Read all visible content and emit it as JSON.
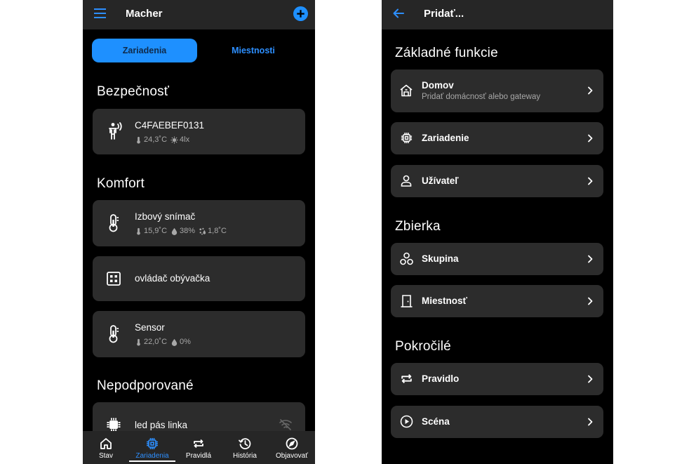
{
  "left": {
    "appbar": {
      "title": "Macher",
      "menu_icon": "menu-icon",
      "add_icon": "add-circle-icon"
    },
    "tabs": [
      {
        "label": "Zariadenia",
        "active": true
      },
      {
        "label": "Miestnosti",
        "active": false
      }
    ],
    "sections": {
      "bezpecnost": {
        "title": "Bezpečnosť",
        "devices": [
          {
            "name": "C4FAEBEF0131",
            "icon": "motion-sensor-icon",
            "temp": "24,3˚C",
            "light": "4lx"
          }
        ]
      },
      "komfort": {
        "title": "Komfort",
        "devices": [
          {
            "name": "Izbový snímač",
            "icon": "thermometer-icon",
            "temp": "15,9˚C",
            "humidity": "38%",
            "dewpoint": "1,8˚C"
          },
          {
            "name": "ovládač obývačka",
            "icon": "switch-panel-icon"
          },
          {
            "name": "Sensor",
            "icon": "thermometer-icon",
            "temp": "22,0˚C",
            "humidity": "0%"
          }
        ]
      },
      "nepodporovane": {
        "title": "Nepodporované",
        "devices": [
          {
            "name": "led pás linka",
            "icon": "chip-icon",
            "status_icon": "wifi-off-icon"
          }
        ]
      }
    },
    "bottom_nav": [
      {
        "label": "Stav",
        "icon": "home-icon",
        "active": false
      },
      {
        "label": "Zariadenia",
        "icon": "chip-icon",
        "active": true
      },
      {
        "label": "Pravidlá",
        "icon": "repeat-icon",
        "active": false
      },
      {
        "label": "História",
        "icon": "history-icon",
        "active": false
      },
      {
        "label": "Objavovať",
        "icon": "compass-icon",
        "active": false
      }
    ],
    "colors": {
      "accent": "#1e90ff",
      "card": "#2c2c2c",
      "bar": "#262626",
      "background": "#000000"
    }
  },
  "right": {
    "appbar": {
      "title": "Pridať...",
      "back_icon": "arrow-back-icon"
    },
    "sections": {
      "zakladne": {
        "title": "Základné funkcie",
        "items": [
          {
            "label": "Domov",
            "subtitle": "Pridať domácnosť alebo gateway",
            "icon": "house-icon"
          },
          {
            "label": "Zariadenie",
            "icon": "chip-icon"
          },
          {
            "label": "Užívateľ",
            "icon": "user-icon"
          }
        ]
      },
      "zbierka": {
        "title": "Zbierka",
        "items": [
          {
            "label": "Skupina",
            "icon": "group-icon"
          },
          {
            "label": "Miestnosť",
            "icon": "door-icon"
          }
        ]
      },
      "pokrocile": {
        "title": "Pokročilé",
        "items": [
          {
            "label": "Pravidlo",
            "icon": "repeat-icon"
          },
          {
            "label": "Scéna",
            "icon": "play-circle-icon"
          }
        ]
      }
    }
  }
}
